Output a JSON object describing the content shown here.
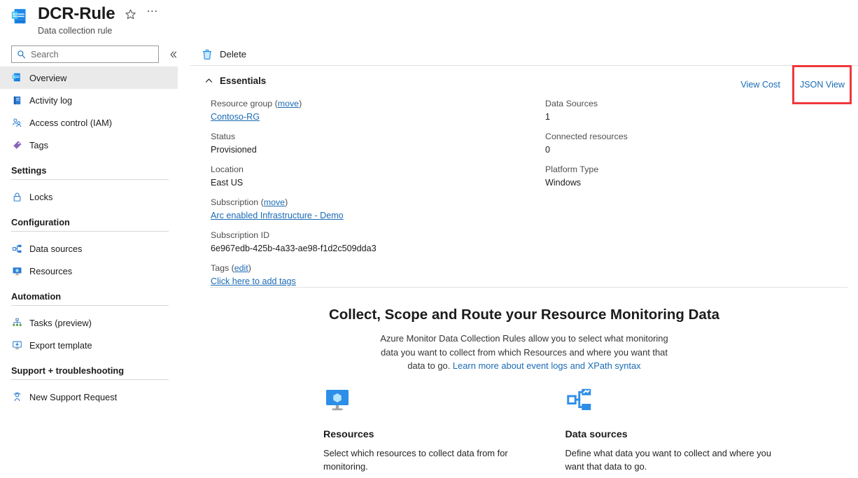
{
  "header": {
    "title": "DCR-Rule",
    "subtitle": "Data collection rule",
    "resource_icon": "data-collection-rule-icon",
    "favorite_icon": "star-icon",
    "more_icon": "ellipsis-icon"
  },
  "search": {
    "placeholder": "Search",
    "value": "",
    "icon": "search-icon",
    "collapse_icon": "chevron-double-left-icon"
  },
  "sidebar": {
    "items": [
      {
        "label": "Overview",
        "icon": "data-collection-rule-icon",
        "selected": true
      },
      {
        "label": "Activity log",
        "icon": "activity-log-icon",
        "selected": false
      },
      {
        "label": "Access control (IAM)",
        "icon": "access-control-icon",
        "selected": false
      },
      {
        "label": "Tags",
        "icon": "tag-icon",
        "selected": false
      }
    ],
    "groups": [
      {
        "title": "Settings",
        "items": [
          {
            "label": "Locks",
            "icon": "lock-icon"
          }
        ]
      },
      {
        "title": "Configuration",
        "items": [
          {
            "label": "Data sources",
            "icon": "data-sources-icon"
          },
          {
            "label": "Resources",
            "icon": "resources-monitor-icon"
          }
        ]
      },
      {
        "title": "Automation",
        "items": [
          {
            "label": "Tasks (preview)",
            "icon": "tasks-tree-icon"
          },
          {
            "label": "Export template",
            "icon": "export-template-icon"
          }
        ]
      },
      {
        "title": "Support + troubleshooting",
        "items": [
          {
            "label": "New Support Request",
            "icon": "support-person-icon"
          }
        ]
      }
    ]
  },
  "toolbar": {
    "delete_label": "Delete",
    "delete_icon": "trash-icon"
  },
  "essentials": {
    "title": "Essentials",
    "collapse_icon": "chevron-up-icon",
    "view_cost_label": "View Cost",
    "json_view_label": "JSON View",
    "highlight_color": "#f0383c",
    "left_fields": [
      {
        "label": "Resource group",
        "label_action": "move",
        "value": "Contoso-RG",
        "value_is_link": true
      },
      {
        "label": "Status",
        "label_action": "",
        "value": "Provisioned",
        "value_is_link": false
      },
      {
        "label": "Location",
        "label_action": "",
        "value": "East US",
        "value_is_link": false
      },
      {
        "label": "Subscription",
        "label_action": "move",
        "value": "Arc enabled Infrastructure - Demo",
        "value_is_link": true
      },
      {
        "label": "Subscription ID",
        "label_action": "",
        "value": "6e967edb-425b-4a33-ae98-f1d2c509dda3",
        "value_is_link": false
      },
      {
        "label": "Tags",
        "label_action": "edit",
        "value": "Click here to add tags",
        "value_is_link": true
      }
    ],
    "right_fields": [
      {
        "label": "Data Sources",
        "value": "1"
      },
      {
        "label": "Connected resources",
        "value": "0"
      },
      {
        "label": "Platform Type",
        "value": "Windows"
      }
    ]
  },
  "hero": {
    "title": "Collect, Scope and Route your Resource Monitoring Data",
    "description": "Azure Monitor Data Collection Rules allow you to select what monitoring data you want to collect from which Resources and where you want that data to go. ",
    "link_text": "Learn more about event logs and XPath syntax"
  },
  "cards": [
    {
      "icon": "resources-monitor-icon",
      "title": "Resources",
      "description": "Select which resources to collect data from for monitoring."
    },
    {
      "icon": "data-sources-icon",
      "title": "Data sources",
      "description": "Define what data you want to collect and where you want that data to go."
    }
  ],
  "colors": {
    "accent_blue": "#0f6cbd",
    "link_blue": "#1a6bb5",
    "selected_bg": "#eaeaea",
    "highlight_red": "#f0383c"
  }
}
